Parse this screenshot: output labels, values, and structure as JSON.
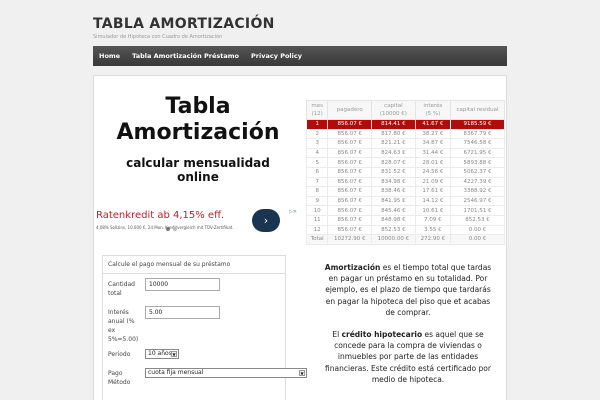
{
  "site": {
    "title": "TABLA AMORTIZACIÓN",
    "description": "Simulador de Hipoteca con Cuadro de Amortización"
  },
  "nav": [
    "Home",
    "Tabla Amortización Préstamo",
    "Privacy Policy"
  ],
  "hero": {
    "title_line1": "Tabla",
    "title_line2": "Amortización",
    "subtitle_line1": "calcular mensualidad",
    "subtitle_line2": "online"
  },
  "ad": {
    "headline": "Ratenkredit ab 4,15% eff.",
    "small": "4,08% Sollzins, 10.000 €, 24 Mon. Kreditvergleich mit TÜV-Zertifikat.",
    "button": "›",
    "info": "▷✕"
  },
  "table": {
    "headers": [
      {
        "l1": "mes",
        "l2": "(12)"
      },
      {
        "l1": "pagadero",
        "l2": ""
      },
      {
        "l1": "capital",
        "l2": "(10000 €)"
      },
      {
        "l1": "interés",
        "l2": "(5 %)"
      },
      {
        "l1": "capital residual",
        "l2": ""
      }
    ],
    "rows": [
      [
        "1",
        "856.07 €",
        "814.41 €",
        "41.67 €",
        "9185.59 €"
      ],
      [
        "2",
        "856.07 €",
        "817.80 €",
        "38.27 €",
        "8367.79 €"
      ],
      [
        "3",
        "856.07 €",
        "821.21 €",
        "34.87 €",
        "7546.58 €"
      ],
      [
        "4",
        "856.07 €",
        "824.63 €",
        "31.44 €",
        "6721.95 €"
      ],
      [
        "5",
        "856.07 €",
        "828.07 €",
        "28.01 €",
        "5893.88 €"
      ],
      [
        "6",
        "856.07 €",
        "831.52 €",
        "24.56 €",
        "5062.37 €"
      ],
      [
        "7",
        "856.07 €",
        "834.98 €",
        "21.09 €",
        "4227.39 €"
      ],
      [
        "8",
        "856.07 €",
        "838.46 €",
        "17.61 €",
        "3388.92 €"
      ],
      [
        "9",
        "856.07 €",
        "841.95 €",
        "14.12 €",
        "2546.97 €"
      ],
      [
        "10",
        "856.07 €",
        "845.46 €",
        "10.61 €",
        "1701.51 €"
      ],
      [
        "11",
        "856.07 €",
        "848.98 €",
        "7.09 €",
        "852.53 €"
      ],
      [
        "12",
        "856.07 €",
        "852.53 €",
        "3.55 €",
        "0.00 €"
      ]
    ],
    "total": [
      "Total",
      "10272.90 €",
      "10000.00 €",
      "272.90 €",
      "0.00 €"
    ]
  },
  "form": {
    "heading": "Calcule el pago mensual de su préstamo",
    "cantidad_label_1": "Cantidad",
    "cantidad_label_2": "total",
    "cantidad_value": "10000",
    "interes_label_1": "Interés",
    "interes_label_2": "anual (%",
    "interes_label_3": "ex",
    "interes_label_4": "5%=5.00)",
    "interes_value": "5.00",
    "periodo_label": "Periodo",
    "periodo_value": "10 años",
    "pago_label_1": "Pago",
    "pago_label_2": "Método",
    "pago_value": "cuota fija mensual"
  },
  "description": {
    "p1_bold": "Amortización",
    "p1_rest": " es el tiempo total que tardas en pagar un préstamo en su totalidad. Por ejemplo, es el plazo de tiempo que tardarás en pagar la hipoteca del piso que et acabas de comprar.",
    "p2_pre": "El ",
    "p2_bold": "crédito hipotecario",
    "p2_rest": " es aquel que se concede para la compra de viviendas o inmuebles por parte de las entidades financieras. Este crédito está certificado por medio de hipoteca."
  },
  "colors": {
    "selected_row": "#b00c0c",
    "nav_bg": "#444444",
    "ad_headline": "#c0202a"
  }
}
